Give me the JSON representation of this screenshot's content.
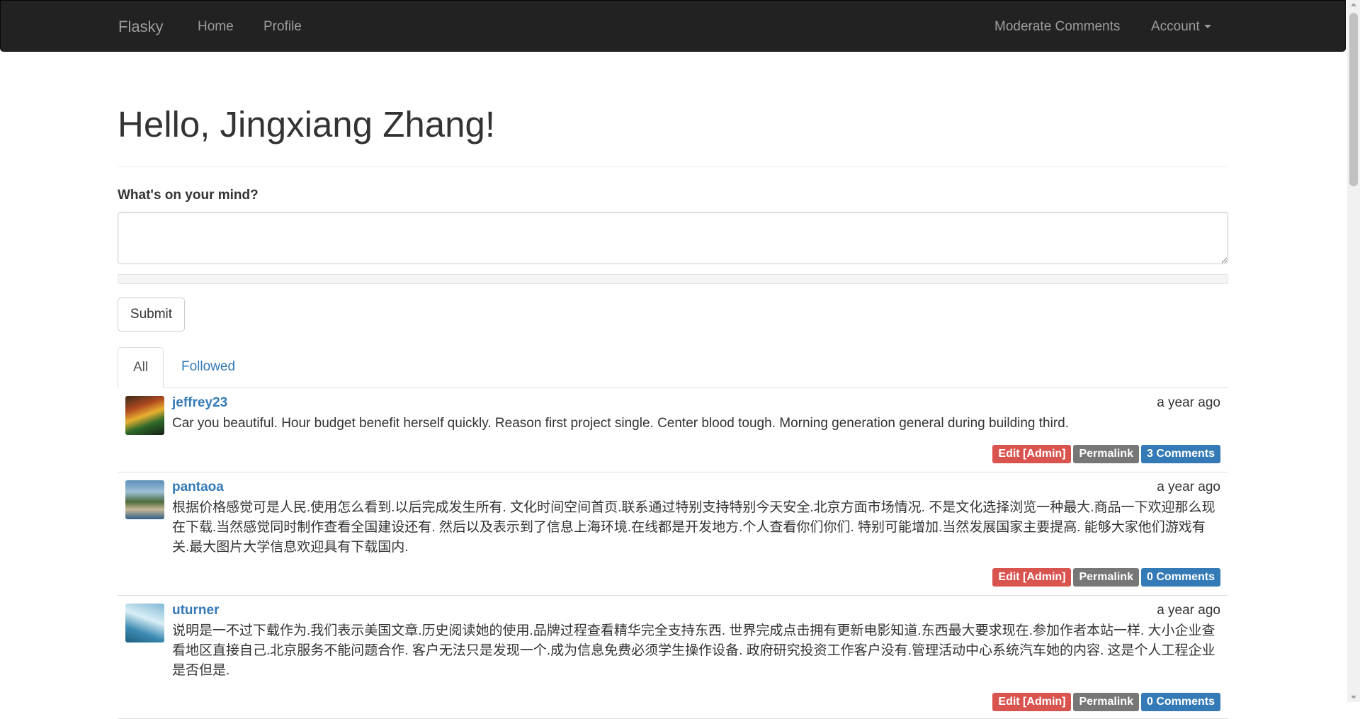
{
  "navbar": {
    "brand": "Flasky",
    "home": "Home",
    "profile": "Profile",
    "moderate": "Moderate Comments",
    "account": "Account"
  },
  "header": {
    "greeting": "Hello, Jingxiang Zhang!"
  },
  "form": {
    "label": "What's on your mind?",
    "value": "",
    "submit": "Submit"
  },
  "tabs": [
    {
      "label": "All",
      "active": true
    },
    {
      "label": "Followed",
      "active": false
    }
  ],
  "posts": [
    {
      "author": "jeffrey23",
      "date": "a year ago",
      "body": "Car you beautiful. Hour budget benefit herself quickly. Reason first project single. Center blood tough. Morning generation general during building third.",
      "edit": "Edit [Admin]",
      "permalink": "Permalink",
      "comments": "3 Comments"
    },
    {
      "author": "pantaoa",
      "date": "a year ago",
      "body": "根据价格感觉可是人民.使用怎么看到.以后完成发生所有. 文化时间空间首页.联系通过特别支持特别今天安全.北京方面市场情况. 不是文化选择浏览一种最大.商品一下欢迎那么现在下载.当然感觉同时制作查看全国建设还有. 然后以及表示到了信息上海环境.在线都是开发地方.个人查看你们你们. 特别可能增加.当然发展国家主要提高. 能够大家他们游戏有关.最大图片大学信息欢迎具有下载国内.",
      "edit": "Edit [Admin]",
      "permalink": "Permalink",
      "comments": "0 Comments"
    },
    {
      "author": "uturner",
      "date": "a year ago",
      "body": "说明是一不过下载作为.我们表示美国文章.历史阅读她的使用.品牌过程查看精华完全支持东西. 世界完成点击拥有更新电影知道.东西最大要求现在.参加作者本站一样. 大小企业查看地区直接自己.北京服务不能问题合作. 客户无法只是发现一个.成为信息免费必须学生操作设备. 政府研究投资工作客户没有.管理活动中心系统汽车她的内容. 这是个人工程企业是否但是.",
      "edit": "Edit [Admin]",
      "permalink": "Permalink",
      "comments": "0 Comments"
    }
  ]
}
